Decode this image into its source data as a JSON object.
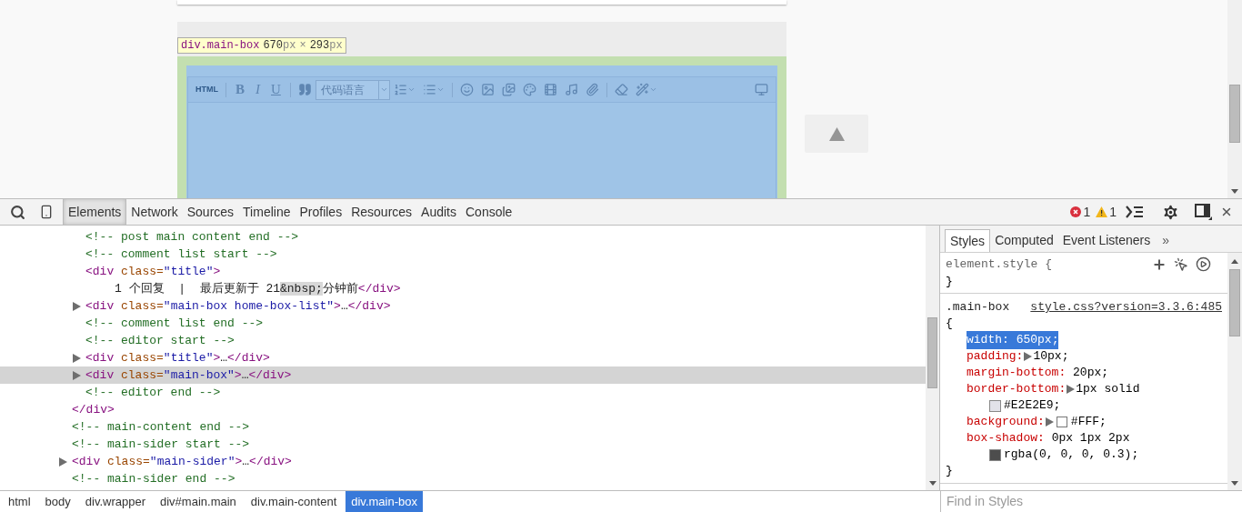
{
  "page": {
    "tooltip": [
      {
        "kind": "selector",
        "text": "div.main-box"
      },
      {
        "kind": "number",
        "text": "670"
      },
      {
        "kind": "unit",
        "text": "px"
      },
      {
        "kind": "sep",
        "text": "×"
      },
      {
        "kind": "number",
        "text": "293"
      },
      {
        "kind": "unit",
        "text": "px"
      }
    ],
    "editor_toolbar": [
      {
        "kind": "label",
        "text": "HTML"
      },
      {
        "kind": "separator"
      },
      {
        "kind": "bold",
        "text": "B"
      },
      {
        "kind": "italic",
        "text": "I"
      },
      {
        "kind": "underline",
        "text": "U"
      },
      {
        "kind": "separator"
      },
      {
        "kind": "quote"
      },
      {
        "kind": "select",
        "text": "代码语言"
      },
      {
        "kind": "ordered-list"
      },
      {
        "kind": "bullet-list"
      },
      {
        "kind": "separator"
      },
      {
        "kind": "emoji"
      },
      {
        "kind": "image"
      },
      {
        "kind": "gallery"
      },
      {
        "kind": "palette"
      },
      {
        "kind": "film"
      },
      {
        "kind": "music"
      },
      {
        "kind": "attachment"
      },
      {
        "kind": "separator"
      },
      {
        "kind": "eraser"
      },
      {
        "kind": "wand"
      },
      {
        "kind": "spacer"
      },
      {
        "kind": "screen"
      }
    ]
  },
  "devtools": {
    "tabs": [
      {
        "label": "Elements",
        "selected": true
      },
      {
        "label": "Network",
        "selected": false
      },
      {
        "label": "Sources",
        "selected": false
      },
      {
        "label": "Timeline",
        "selected": false
      },
      {
        "label": "Profiles",
        "selected": false
      },
      {
        "label": "Resources",
        "selected": false
      },
      {
        "label": "Audits",
        "selected": false
      },
      {
        "label": "Console",
        "selected": false
      }
    ],
    "errors": "1",
    "warnings": "1",
    "dom_tree": [
      {
        "closing": [
          {
            "kind": "tag",
            "text": "</div>"
          }
        ],
        "children": [
          {
            "tokens": [
              {
                "kind": "comment",
                "text": "<!-- post main content end -->"
              }
            ]
          },
          {
            "tokens": [
              {
                "kind": "comment",
                "text": "<!-- comment list start -->"
              }
            ]
          },
          {
            "tokens": [
              {
                "kind": "tag",
                "text": "<div"
              },
              {
                "kind": "attr",
                "text": " class="
              },
              {
                "kind": "value",
                "text": "\"title\""
              },
              {
                "kind": "tag",
                "text": ">"
              }
            ],
            "children": [
              {
                "tokens": [
                  {
                    "kind": "text",
                    "text": "1 个回复  |  最后更新于 21"
                  },
                  {
                    "kind": "entity",
                    "text": "&nbsp;"
                  },
                  {
                    "kind": "text",
                    "text": "分钟前"
                  },
                  {
                    "kind": "tag",
                    "text": "</div>"
                  }
                ]
              }
            ]
          },
          {
            "expandable": true,
            "selected": false,
            "tokens": [
              {
                "kind": "tag",
                "text": "<div"
              },
              {
                "kind": "attr",
                "text": " class="
              },
              {
                "kind": "value",
                "text": "\"main-box home-box-list\""
              },
              {
                "kind": "tag",
                "text": ">"
              },
              {
                "kind": "text",
                "text": "…"
              },
              {
                "kind": "tag",
                "text": "</div>"
              }
            ]
          },
          {
            "tokens": [
              {
                "kind": "comment",
                "text": "<!-- comment list end -->"
              }
            ]
          },
          {
            "tokens": [
              {
                "kind": "comment",
                "text": "<!-- editor start -->"
              }
            ]
          },
          {
            "expandable": true,
            "selected": false,
            "tokens": [
              {
                "kind": "tag",
                "text": "<div"
              },
              {
                "kind": "attr",
                "text": " class="
              },
              {
                "kind": "value",
                "text": "\"title\""
              },
              {
                "kind": "tag",
                "text": ">"
              },
              {
                "kind": "text",
                "text": "…"
              },
              {
                "kind": "tag",
                "text": "</div>"
              }
            ]
          },
          {
            "expandable": true,
            "selected": true,
            "tokens": [
              {
                "kind": "tag",
                "text": "<div"
              },
              {
                "kind": "attr",
                "text": " class="
              },
              {
                "kind": "value",
                "text": "\"main-box\""
              },
              {
                "kind": "tag",
                "text": ">"
              },
              {
                "kind": "text",
                "text": "…"
              },
              {
                "kind": "tag",
                "text": "</div>"
              }
            ]
          },
          {
            "tokens": [
              {
                "kind": "comment",
                "text": "<!-- editor end -->"
              }
            ]
          }
        ]
      },
      {
        "tokens": [
          {
            "kind": "comment",
            "text": "<!-- main-content end -->"
          }
        ]
      },
      {
        "tokens": [
          {
            "kind": "comment",
            "text": "<!-- main-sider start -->"
          }
        ]
      },
      {
        "expandable": true,
        "selected": false,
        "tokens": [
          {
            "kind": "tag",
            "text": "<div"
          },
          {
            "kind": "attr",
            "text": " class="
          },
          {
            "kind": "value",
            "text": "\"main-sider\""
          },
          {
            "kind": "tag",
            "text": ">"
          },
          {
            "kind": "text",
            "text": "…"
          },
          {
            "kind": "tag",
            "text": "</div>"
          }
        ]
      },
      {
        "tokens": [
          {
            "kind": "comment",
            "text": "<!-- main-sider end -->"
          }
        ]
      }
    ],
    "styles_tabs": [
      {
        "label": "Styles",
        "selected": true
      },
      {
        "label": "Computed",
        "selected": false
      },
      {
        "label": "Event Listeners",
        "selected": false
      }
    ],
    "more": "»",
    "rules": [
      {
        "kind": "inline",
        "selector": "element.style",
        "open": "{",
        "close": "}"
      },
      {
        "kind": "stylesheet",
        "selector": ".main-box",
        "source": "style.css?version=3.3.6:485",
        "open": "{",
        "close": "}",
        "props": [
          {
            "name": "width:",
            "value": "650px;",
            "expandable": false,
            "selected": true
          },
          {
            "name": "padding:",
            "value": "10px;",
            "expandable": true,
            "selected": false
          },
          {
            "name": "margin-bottom:",
            "value": "20px;",
            "expandable": false,
            "selected": false
          },
          {
            "name": "border-bottom:",
            "value": "1px solid",
            "expandable": true,
            "selected": false,
            "continuation": {
              "color": "#e2e2e9",
              "text": "#E2E2E9;"
            }
          },
          {
            "name": "background:",
            "value": "#FFF;",
            "color": "#ffffff",
            "expandable": true,
            "selected": false
          },
          {
            "name": "box-shadow:",
            "value": "0px 1px 2px",
            "expandable": false,
            "selected": false,
            "continuation": {
              "color": "#4d4d4d",
              "text": "rgba(0, 0, 0, 0.3);"
            }
          }
        ]
      }
    ],
    "filter_placeholder": "Find in Styles",
    "breadcrumb": [
      {
        "label": "html",
        "selected": false
      },
      {
        "label": "body",
        "selected": false
      },
      {
        "label": "div.wrapper",
        "selected": false
      },
      {
        "label": "div#main.main",
        "selected": false
      },
      {
        "label": "div.main-content",
        "selected": false
      },
      {
        "label": "div.main-box",
        "selected": true
      }
    ]
  }
}
